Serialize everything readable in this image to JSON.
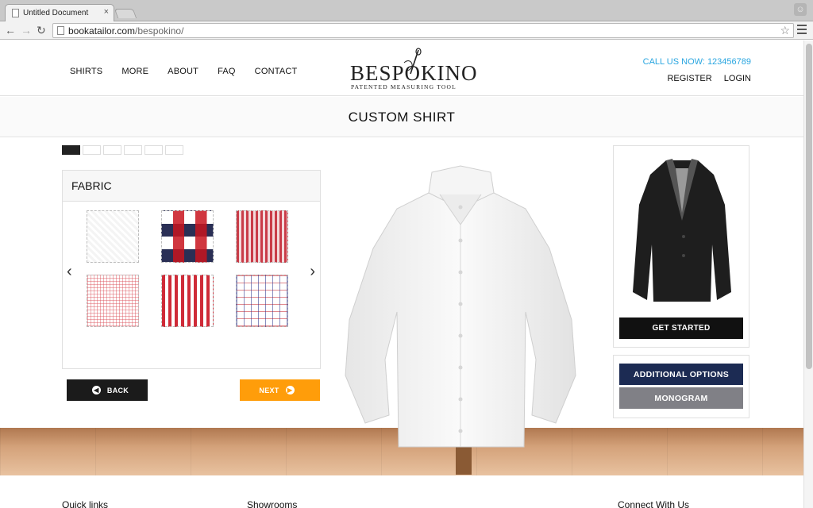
{
  "browser": {
    "tab_title": "Untitled Document",
    "tab_close": "×",
    "url_domain": "bookatailor.com",
    "url_path": "/bespokino/",
    "back_icon": "arrow-left-icon",
    "forward_icon": "arrow-right-icon",
    "reload_icon": "reload-icon"
  },
  "header": {
    "nav": [
      "SHIRTS",
      "MORE",
      "ABOUT",
      "FAQ",
      "CONTACT"
    ],
    "logo_brand": "BESPOKINO",
    "logo_tagline": "PATENTED MEASURING TOOL",
    "call_us": "CALL US NOW: 123456789",
    "register": "REGISTER",
    "login": "LOGIN"
  },
  "page_title": "CUSTOM SHIRT",
  "steps": {
    "total": 6,
    "current": 1
  },
  "fabric_panel": {
    "title": "FABRIC",
    "prev": "‹",
    "next_arrow": "›"
  },
  "buttons": {
    "back": "BACK",
    "next": "NEXT",
    "get_started": "GET STARTED",
    "additional_options": "ADDITIONAL OPTIONS",
    "monogram": "MONOGRAM"
  },
  "footer": {
    "quick_links": "Quick links",
    "showrooms": "Showrooms",
    "connect": "Connect With Us"
  },
  "colors": {
    "accent_orange": "#ff9d0a",
    "navy": "#1c2b53",
    "call_blue": "#2aa6e0"
  }
}
